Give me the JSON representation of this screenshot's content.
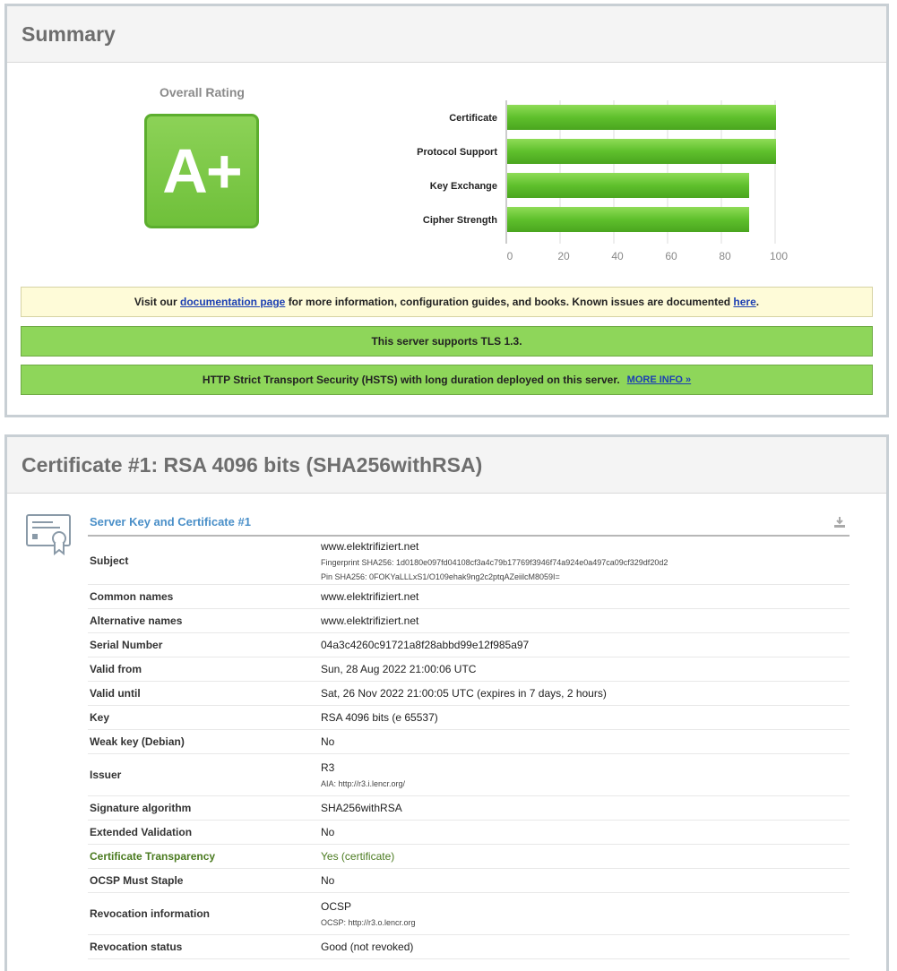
{
  "summary": {
    "title": "Summary",
    "rating_label": "Overall Rating",
    "grade": "A+",
    "grade_color": "#7ac943",
    "notices": {
      "docs_prefix": "Visit our ",
      "docs_link": "documentation page",
      "docs_middle": " for more information, configuration guides, and books. Known issues are documented ",
      "docs_link2": "here",
      "docs_suffix": ".",
      "tls": "This server supports TLS 1.3.",
      "hsts": "HTTP Strict Transport Security (HSTS) with long duration deployed on this server.",
      "hsts_more": "MORE INFO »"
    }
  },
  "chart_data": {
    "type": "bar",
    "orientation": "horizontal",
    "categories": [
      "Certificate",
      "Protocol Support",
      "Key Exchange",
      "Cipher Strength"
    ],
    "values": [
      100,
      100,
      90,
      90
    ],
    "xlim": [
      0,
      100
    ],
    "xticks": [
      0,
      20,
      40,
      60,
      80,
      100
    ],
    "bar_color": "#5cbf2a",
    "grid": false
  },
  "certificate": {
    "title": "Certificate #1: RSA 4096 bits (SHA256withRSA)",
    "section_title": "Server Key and Certificate #1",
    "rows": [
      {
        "key": "Subject",
        "value": "www.elektrifiziert.net",
        "sub1": "Fingerprint SHA256: 1d0180e097fd04108cf3a4c79b17769f3946f74a924e0a497ca09cf329df20d2",
        "sub2": "Pin SHA256: 0FOKYaLLLxS1/O109ehak9ng2c2ptqAZeiilcM8059I="
      },
      {
        "key": "Common names",
        "value": "www.elektrifiziert.net"
      },
      {
        "key": "Alternative names",
        "value": "www.elektrifiziert.net"
      },
      {
        "key": "Serial Number",
        "value": "04a3c4260c91721a8f28abbd99e12f985a97"
      },
      {
        "key": "Valid from",
        "value": "Sun, 28 Aug 2022 21:00:06 UTC"
      },
      {
        "key": "Valid until",
        "value": "Sat, 26 Nov 2022 21:00:05 UTC (expires in 7 days, 2 hours)"
      },
      {
        "key": "Key",
        "value": "RSA 4096 bits (e 65537)"
      },
      {
        "key": "Weak key (Debian)",
        "value": "No"
      },
      {
        "key": "Issuer",
        "value": "R3",
        "sub1": "AIA: http://r3.i.lencr.org/"
      },
      {
        "key": "Signature algorithm",
        "value": "SHA256withRSA"
      },
      {
        "key": "Extended Validation",
        "value": "No"
      },
      {
        "key": "Certificate Transparency",
        "value": "Yes (certificate)"
      },
      {
        "key": "OCSP Must Staple",
        "value": "No"
      },
      {
        "key": "Revocation information",
        "value": "OCSP",
        "sub1": "OCSP: http://r3.o.lencr.org"
      },
      {
        "key": "Revocation status",
        "value": "Good (not revoked)"
      }
    ]
  }
}
